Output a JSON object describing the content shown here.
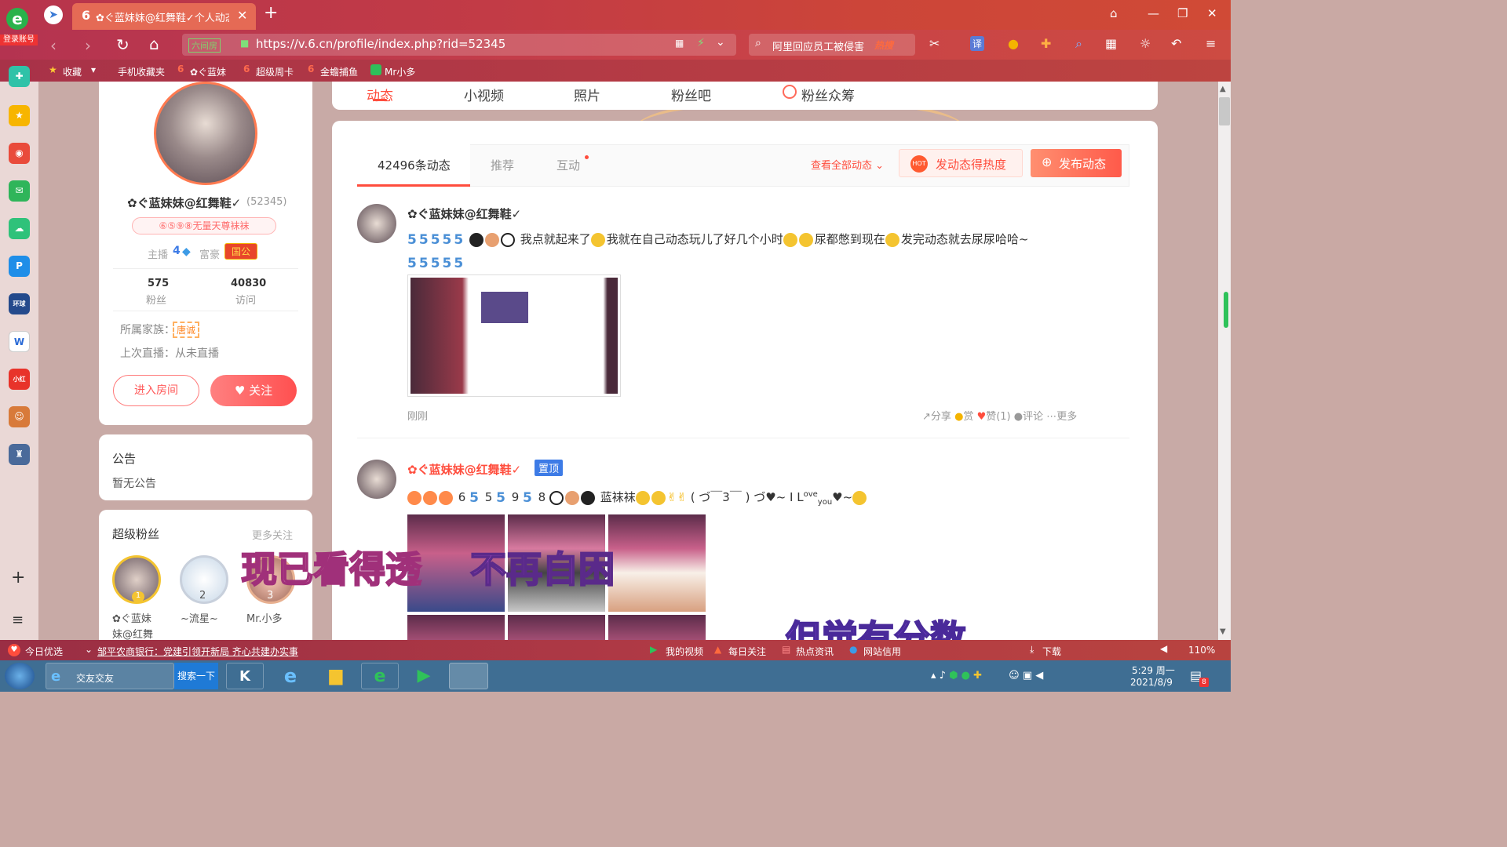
{
  "browser": {
    "login_badge": "登录账号",
    "tab_title": "✿ぐ蓝妹妹@红舞鞋✓个人动态",
    "new_tab": "+",
    "url": "https://v.6.cn/profile/index.php?rid=52345",
    "url_prefix_badge": "六间房",
    "search_text": "阿里回应员工被侵害",
    "search_hot": "热搜",
    "translate_label": "译"
  },
  "favorites": [
    {
      "label": "收藏"
    },
    {
      "label": "手机收藏夹"
    },
    {
      "label": "✿ぐ蓝妹"
    },
    {
      "label": "超级周卡"
    },
    {
      "label": "金蟾捕鱼"
    },
    {
      "label": "Mr小多"
    }
  ],
  "profile_nav": {
    "tabs": [
      "动态",
      "小视频",
      "照片",
      "粉丝吧",
      "粉丝众筹"
    ]
  },
  "profile": {
    "name": "✿ぐ蓝妹妹@红舞鞋✓",
    "rid": "(52345)",
    "badge": "⑥⑤⑨⑧无量天尊袜袜",
    "anchor_label": "主播",
    "anchor_level": "4",
    "rich_label": "富豪",
    "rich_level": "国公",
    "fans_count": "575",
    "fans_label": "粉丝",
    "visits_count": "40830",
    "visits_label": "访问",
    "family_label": "所属家族：",
    "family_value": "唐诚",
    "last_live": "上次直播：从未直播",
    "enter_room": "进入房间",
    "follow": "关注"
  },
  "notice": {
    "title": "公告",
    "content": "暂无公告"
  },
  "super_fans": {
    "title": "超级粉丝",
    "more": "更多关注",
    "fans": [
      {
        "rank": "1",
        "name": "✿ぐ蓝妹",
        "name2": "妹@红舞"
      },
      {
        "rank": "2",
        "name": "~流星~"
      },
      {
        "rank": "3",
        "name": "Mr.小多"
      }
    ]
  },
  "feed": {
    "tabs": [
      {
        "label": "42496条动态"
      },
      {
        "label": "推荐"
      },
      {
        "label": "互动"
      }
    ],
    "view_all": "查看全部动态",
    "hot_button": "发动态得热度",
    "post_button": "发布动态",
    "posts": [
      {
        "author": "✿ぐ蓝妹妹@红舞鞋✓",
        "text1": "我点就起来了",
        "text2": "我就在自己动态玩儿了好几个小时",
        "text3": "尿都憋到现在",
        "text4": "发完动态就去尿尿哈哈~",
        "time": "刚刚",
        "actions": {
          "share": "分享",
          "reward": "赏",
          "like": "赞(1)",
          "comment": "评论",
          "more": "更多"
        }
      },
      {
        "author": "✿ぐ蓝妹妹@红舞鞋✓",
        "pinned": "置顶",
        "nums": [
          "6",
          "5",
          "9",
          "8"
        ],
        "text1": "蓝袜袜",
        "text2": "( づ￣3￣ ) づ",
        "text3": "~ I L",
        "text4": "ove",
        "text5": "you",
        "text6": "~"
      }
    ]
  },
  "overlay": {
    "line1": "现已看得透",
    "line2": "不再自困",
    "line3": "但觉有分数"
  },
  "statusbar": {
    "left1": "今日优选",
    "news": "邹平农商银行：党建引领开新局 齐心共建办实事",
    "my_video": "我的视频",
    "daily": "每日关注",
    "hot_news": "热点资讯",
    "site_credit": "网站信用",
    "download": "下载",
    "zoom": "110%"
  },
  "taskbar": {
    "ie_label": "交友交友",
    "search_label": "搜索一下",
    "time": "5:29 周一",
    "date": "2021/8/9",
    "notif_count": "8"
  },
  "colors": {
    "accent": "#ff5a4a",
    "brand_red": "#e8473a",
    "blue_emoji": "#4a8fd6"
  }
}
